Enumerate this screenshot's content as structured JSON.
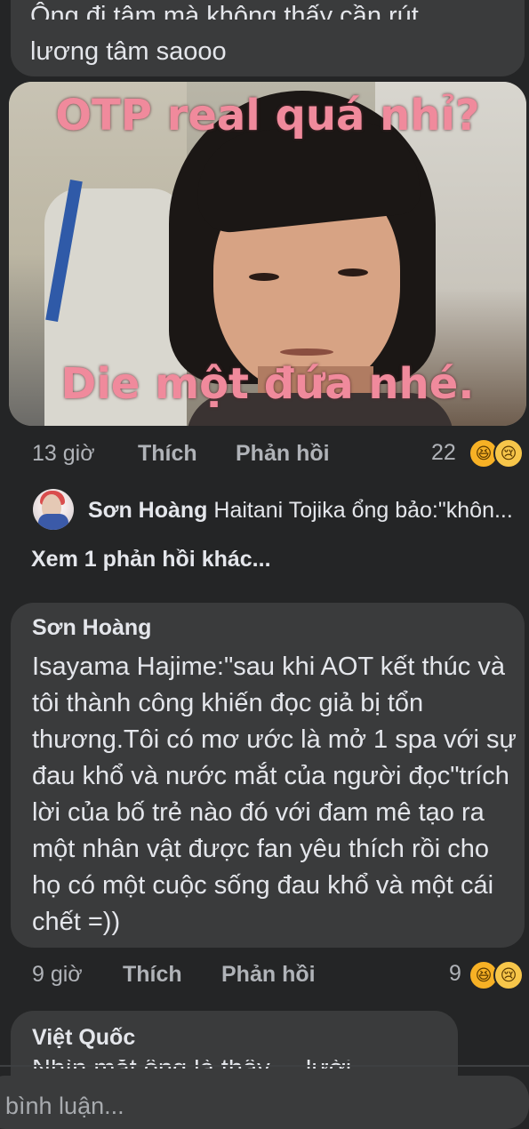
{
  "top_comment": {
    "line1": "Ông đi tâm mà không thấy cần rút",
    "line2": "lương tâm saooo"
  },
  "meme": {
    "top_text": "OTP real quá nhỉ?",
    "bottom_text": "Die một đứa nhé."
  },
  "comment1_actions": {
    "time": "13 giờ",
    "like": "Thích",
    "reply": "Phản hồi",
    "reaction_count": "22",
    "reactions": [
      "haha-icon",
      "sad-icon"
    ]
  },
  "reply_preview": {
    "name": "Sơn Hoàng",
    "text": "Haitani Tojika ổng bảo:\"khôn..."
  },
  "more_replies": "Xem 1 phản hồi khác...",
  "comment2": {
    "name": "Sơn Hoàng",
    "body": "Isayama Hajime:\"sau khi AOT kết thúc và tôi thành công khiến đọc giả bị tổn thương.Tôi có mơ ước là mở 1 spa với sự đau khổ và nước mắt của người đọc\"trích lời của bố trẻ nào đó với đam mê tạo ra một nhân vật được fan yêu thích rồi cho họ có một cuộc sống đau khổ và một cái chết =))"
  },
  "comment2_actions": {
    "time": "9 giờ",
    "like": "Thích",
    "reply": "Phản hồi",
    "reaction_count": "9",
    "reactions": [
      "haha-icon",
      "sad-icon"
    ]
  },
  "comment3": {
    "name": "Việt Quốc",
    "cut_text": "Nhìn mặt ổng là thấy ... lười"
  },
  "composer": {
    "placeholder": "bình luận..."
  },
  "colors": {
    "background": "#242526",
    "bubble": "#3a3b3c",
    "text": "#e4e6eb",
    "muted": "#b0b3b8",
    "meme_text": "#f08a9c"
  }
}
